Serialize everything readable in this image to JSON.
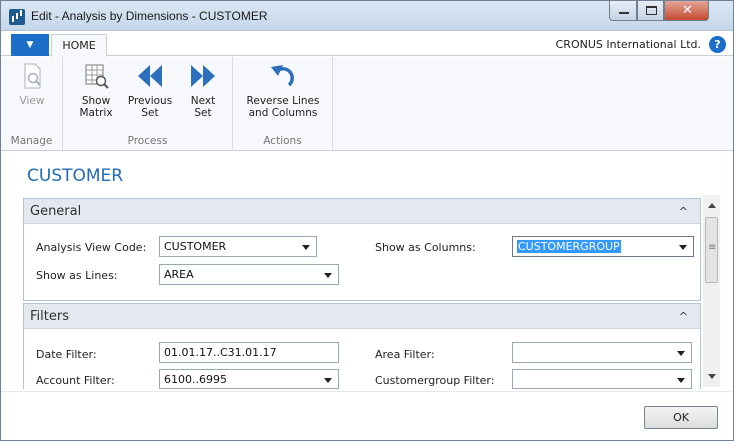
{
  "window": {
    "title": "Edit - Analysis by Dimensions - CUSTOMER",
    "close_glyph": "✕"
  },
  "ribbon": {
    "file_tab_glyph": "▼",
    "home_tab": "HOME",
    "company": "CRONUS International Ltd.",
    "help_glyph": "?",
    "groups": [
      {
        "label": "Manage",
        "buttons": [
          {
            "label": "View",
            "icon": "view-icon",
            "enabled": false
          }
        ]
      },
      {
        "label": "Process",
        "buttons": [
          {
            "label": "Show\nMatrix",
            "icon": "matrix-icon",
            "enabled": true
          },
          {
            "label": "Previous\nSet",
            "icon": "previous-icon",
            "enabled": true
          },
          {
            "label": "Next\nSet",
            "icon": "next-icon",
            "enabled": true
          }
        ]
      },
      {
        "label": "Actions",
        "buttons": [
          {
            "label": "Reverse Lines\nand Columns",
            "icon": "reverse-icon",
            "enabled": true
          }
        ]
      }
    ]
  },
  "page": {
    "title": "CUSTOMER"
  },
  "general": {
    "heading": "General",
    "analysis_view_code_label": "Analysis View Code:",
    "analysis_view_code_value": "CUSTOMER",
    "show_as_lines_label": "Show as Lines:",
    "show_as_lines_value": "AREA",
    "show_as_columns_label": "Show as Columns:",
    "show_as_columns_value": "CUSTOMERGROUP"
  },
  "filters": {
    "heading": "Filters",
    "date_filter_label": "Date Filter:",
    "date_filter_value": "01.01.17..C31.01.17",
    "account_filter_label": "Account Filter:",
    "account_filter_value": "6100..6995",
    "area_filter_label": "Area Filter:",
    "area_filter_value": "",
    "customergroup_filter_label": "Customergroup Filter:",
    "customergroup_filter_value": ""
  },
  "footer": {
    "ok_label": "OK"
  },
  "colors": {
    "accent": "#1f6bb5",
    "file_tab": "#1c6ec9",
    "arrow": "#2e6fbd"
  }
}
